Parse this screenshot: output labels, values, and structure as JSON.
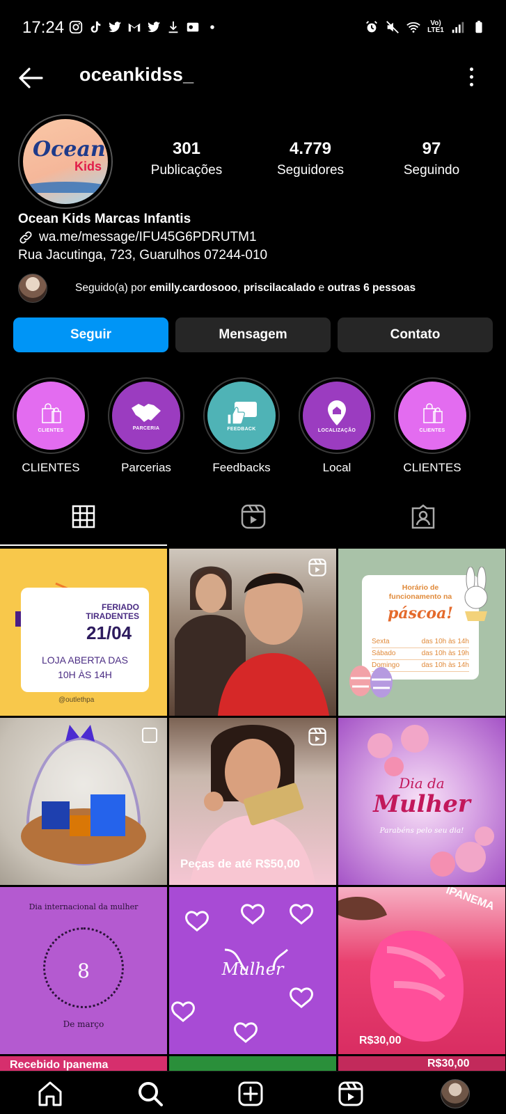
{
  "status_bar": {
    "time": "17:24",
    "left_icons": [
      "instagram-icon",
      "tiktok-icon",
      "twitter-icon",
      "gmail-icon",
      "twitter-icon",
      "download-icon",
      "outlook-icon",
      "dot-icon"
    ],
    "right_icons": [
      "alarm-icon",
      "mute-icon",
      "wifi-icon",
      "lte-icon",
      "signal-icon",
      "battery-icon"
    ],
    "network_label": "Vo) LTE1"
  },
  "header": {
    "username": "oceankidss_"
  },
  "profile": {
    "avatar_text_main": "Ocean",
    "avatar_text_sub": "Kids",
    "stats": [
      {
        "value": "301",
        "label": "Publicações"
      },
      {
        "value": "4.779",
        "label": "Seguidores"
      },
      {
        "value": "97",
        "label": "Seguindo"
      }
    ],
    "name": "Ocean Kids Marcas Infantis",
    "link": "wa.me/message/IFU45G6PDRUTM1",
    "address": "Rua Jacutinga, 723, Guarulhos 07244-010",
    "followed_by": {
      "prefix": "Seguido(a) por ",
      "user1": "emilly.cardosooo",
      "separator": ", ",
      "user2": "priscilacalado",
      "connector": " e ",
      "others": "outras 6 pessoas"
    }
  },
  "actions": {
    "follow": "Seguir",
    "message": "Mensagem",
    "contact": "Contato"
  },
  "highlights": [
    {
      "title": "CLIENTES",
      "caption": "CLIENTES",
      "icon": "shopping-bags-icon",
      "color": "#e36cf0"
    },
    {
      "title": "Parcerias",
      "caption": "PARCERIA",
      "icon": "handshake-icon",
      "color": "#9b3cc0"
    },
    {
      "title": "Feedbacks",
      "caption": "FEEDBACK",
      "icon": "thumbs-up-icon",
      "color": "#4fb3b6"
    },
    {
      "title": "Local",
      "caption": "LOCALIZAÇÃO",
      "icon": "location-pin-icon",
      "color": "#9b3cc0"
    },
    {
      "title": "CLIENTES",
      "caption": "CLIENTES",
      "icon": "shopping-bags-icon",
      "color": "#e36cf0"
    }
  ],
  "tabs": [
    "grid-icon",
    "reels-icon",
    "tagged-icon"
  ],
  "posts": {
    "p1": {
      "line1": "FERIADO",
      "line2": "TIRADENTES",
      "date": "21/04",
      "line3": "LOJA ABERTA DAS",
      "line4": "10H ÀS 14H",
      "handle": "@outlethpa"
    },
    "p3": {
      "title1": "Horário de",
      "title2": "funcionamento na",
      "title3": "páscoa!",
      "rows": [
        {
          "day": "Sexta",
          "hours": "das 10h às 14h"
        },
        {
          "day": "Sábado",
          "hours": "das 10h às 19h"
        },
        {
          "day": "Domingo",
          "hours": "das 10h às 14h"
        }
      ]
    },
    "p5": {
      "text": "Peças de até R$50,00"
    },
    "p6": {
      "line1": "Dia da",
      "line2": "Mulher",
      "line3": "Parabéns pelo seu dia!"
    },
    "p7": {
      "top": "Dia internacional da mulher",
      "number": "8",
      "bottom": "De março"
    },
    "p8": {
      "word": "Mulher"
    },
    "p9": {
      "brand": "IPANEMA",
      "price": "R$30,00"
    },
    "p10": {
      "text": "Recebido Ipanema"
    },
    "p12": {
      "price": "R$30,00"
    }
  },
  "bottom_nav": [
    "home-icon",
    "search-icon",
    "create-icon",
    "reels-icon",
    "profile-avatar"
  ]
}
